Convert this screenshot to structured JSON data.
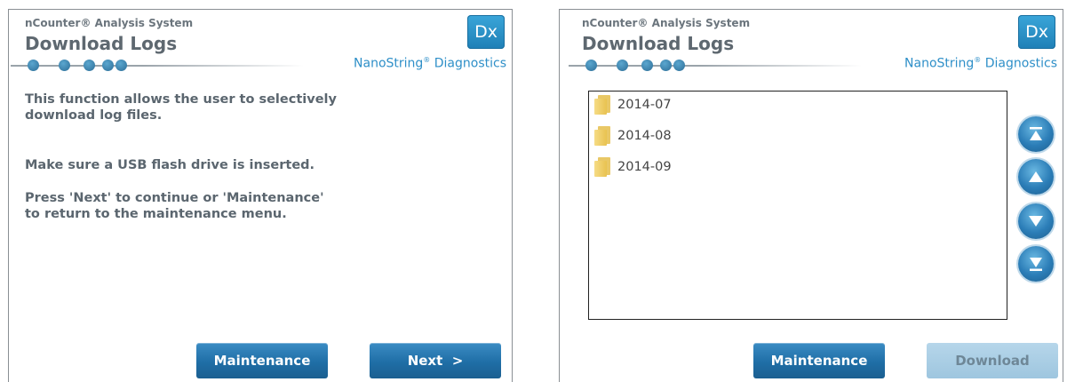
{
  "left": {
    "system_name": "nCounter® Analysis System",
    "title": "Download Logs",
    "badge": "Dx",
    "brand": "NanoString",
    "brand_suffix": "Diagnostics",
    "paragraphs": [
      "This function allows the user to selectively download log files.",
      "Make sure a USB flash drive is inserted.",
      "Press 'Next' to continue or 'Maintenance' to return to the maintenance menu."
    ],
    "maintenance_label": "Maintenance",
    "next_label": "Next  >"
  },
  "right": {
    "system_name": "nCounter® Analysis System",
    "title": "Download Logs",
    "badge": "Dx",
    "brand": "NanoString",
    "brand_suffix": "Diagnostics",
    "folders": [
      "2014-07",
      "2014-08",
      "2014-09"
    ],
    "maintenance_label": "Maintenance",
    "download_label": "Download"
  },
  "icons": {
    "scroll_top": "scroll-to-top-icon",
    "scroll_up": "scroll-up-icon",
    "scroll_down": "scroll-down-icon",
    "scroll_bottom": "scroll-to-bottom-icon",
    "folder": "folder-icon"
  },
  "colors": {
    "accent": "#2e8fc8",
    "button": "#1f6ea6",
    "button_disabled": "#a9cde4"
  }
}
